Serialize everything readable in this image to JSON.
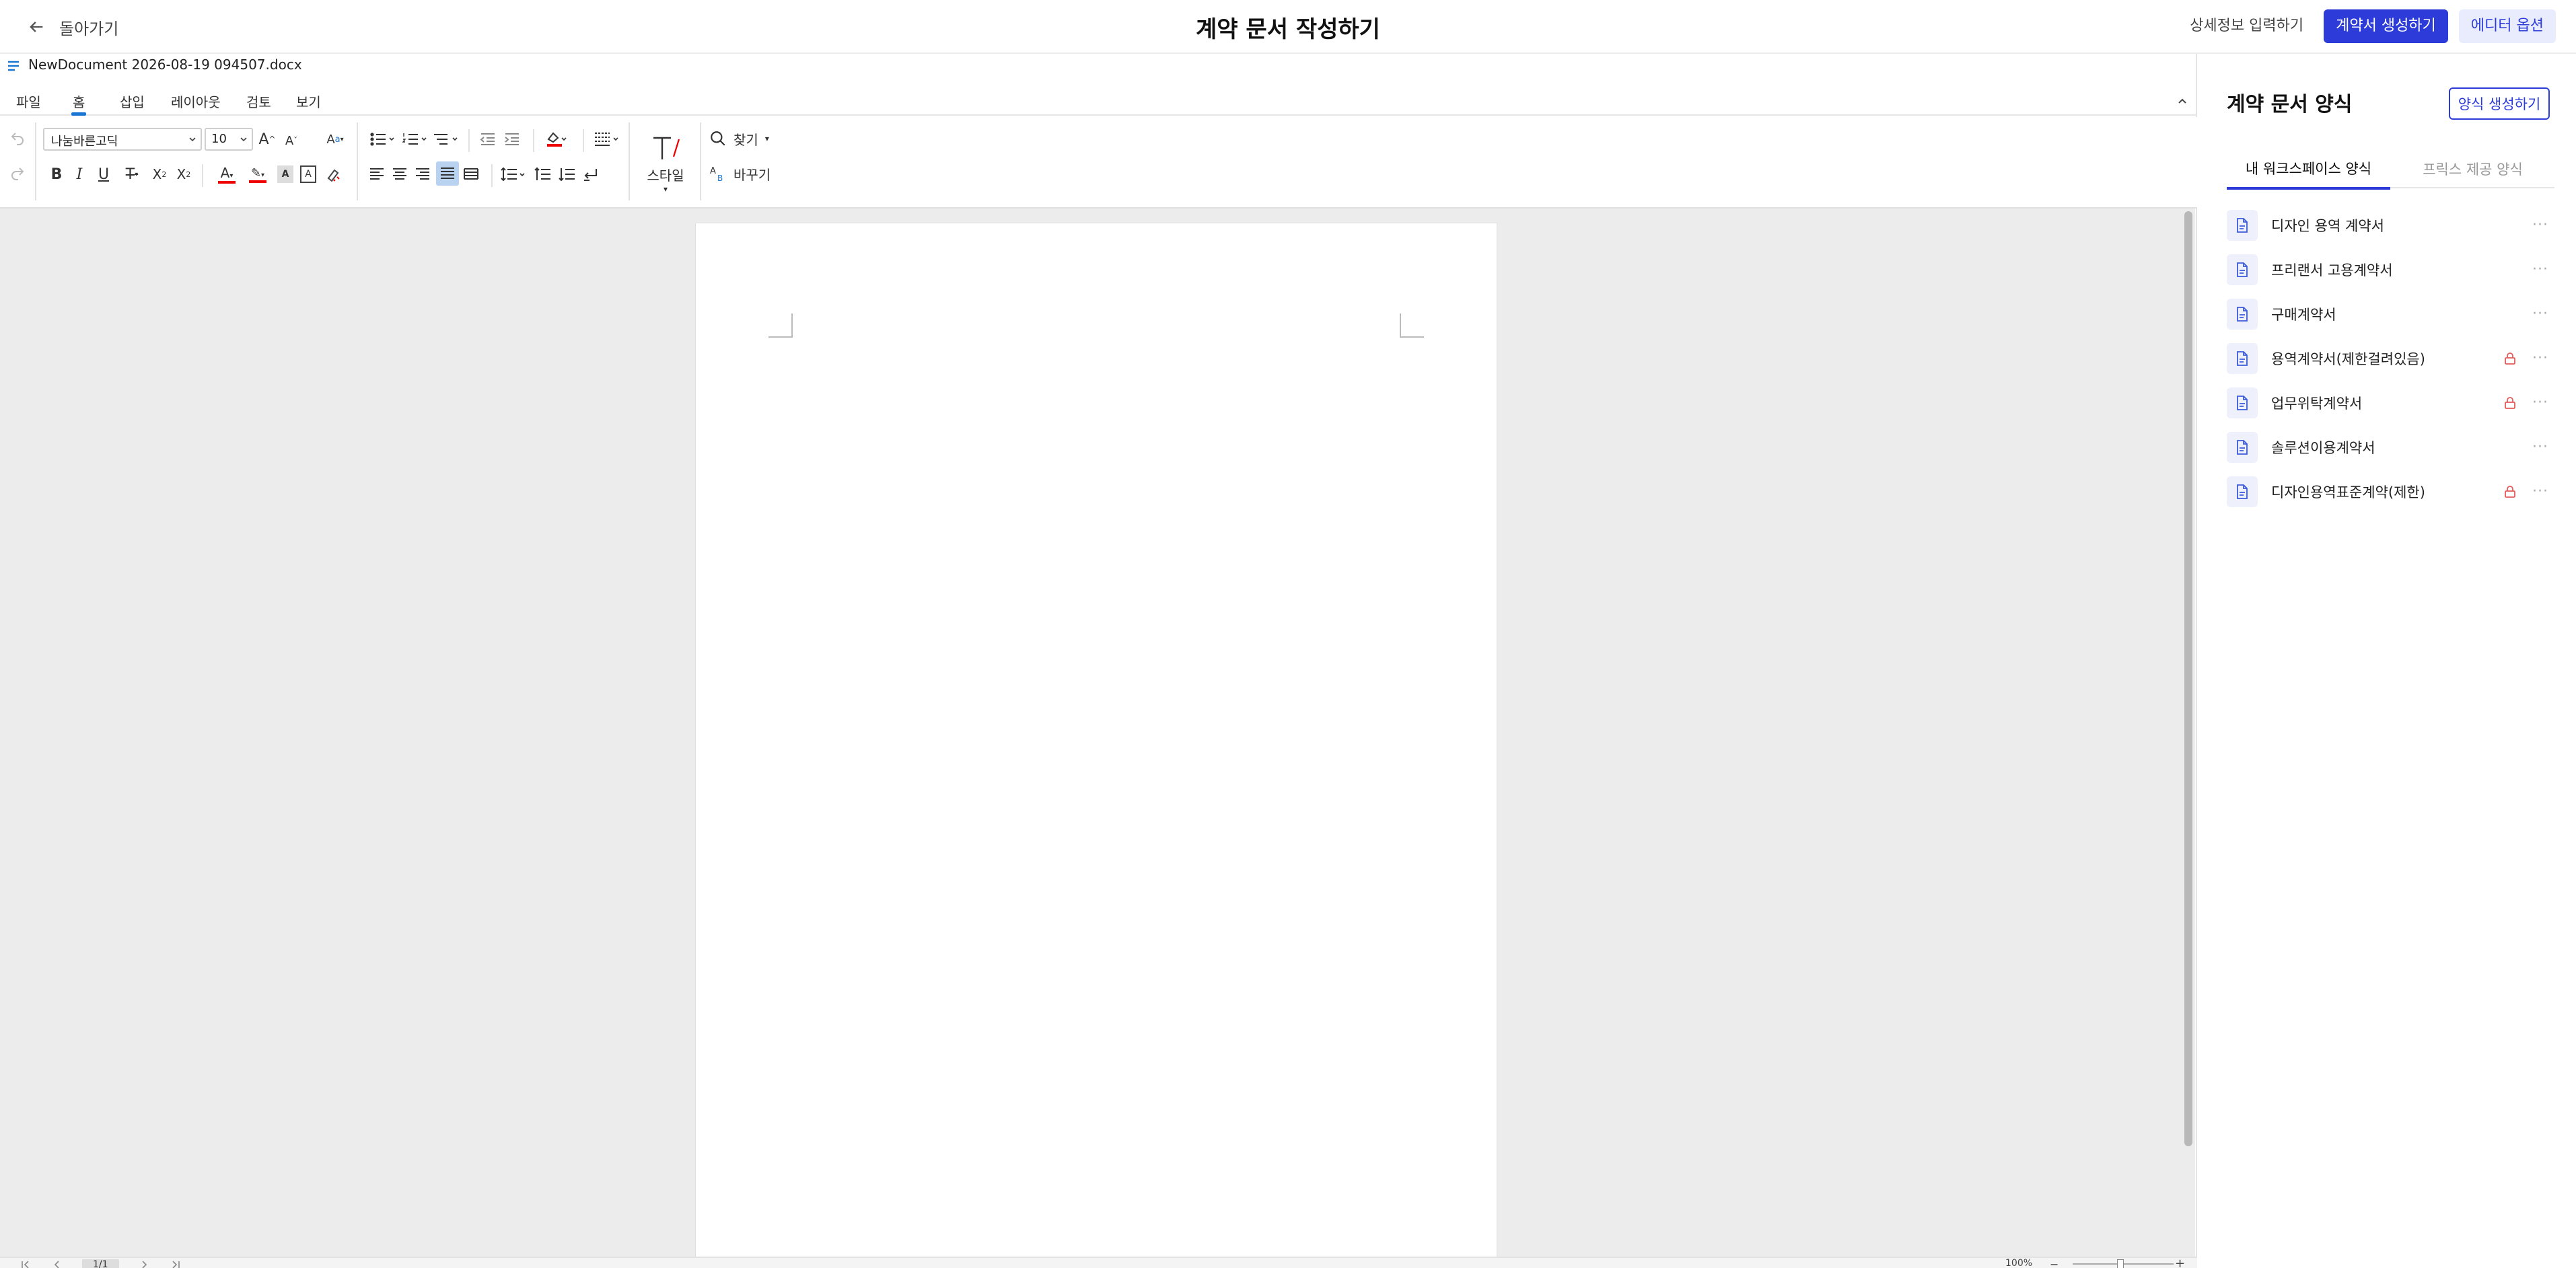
{
  "header": {
    "back_label": "돌아가기",
    "title": "계약 문서 작성하기",
    "detail_label": "상세정보 입력하기",
    "generate_label": "계약서 생성하기",
    "options_label": "에디터 옵션",
    "accent_color": "#2d3cd8"
  },
  "editor": {
    "filename": "NewDocument 2026-08-19 094507.docx",
    "menu": [
      "파일",
      "홈",
      "삽입",
      "레이아웃",
      "검토",
      "보기"
    ],
    "active_menu": "홈",
    "font_name": "나눔바른고딕",
    "font_size": "10",
    "style_label": "스타일",
    "find_label": "찾기",
    "replace_label": "바꾸기",
    "status": {
      "page": "1/1",
      "zoom": "100%"
    }
  },
  "sidebar": {
    "title": "계약 문서 양식",
    "create_label": "양식 생성하기",
    "tabs": [
      "내 워크스페이스 양식",
      "프릭스 제공 양식"
    ],
    "active_tab": 0,
    "templates": [
      {
        "name": "디자인 용역 계약서",
        "locked": false
      },
      {
        "name": "프리랜서 고용계약서",
        "locked": false
      },
      {
        "name": "구매계약서",
        "locked": false
      },
      {
        "name": "용역계약서(제한걸려있음)",
        "locked": true
      },
      {
        "name": "업무위탁계약서",
        "locked": true
      },
      {
        "name": "솔루션이용계약서",
        "locked": false
      },
      {
        "name": "디자인용역표준계약(제한)",
        "locked": true
      }
    ],
    "lock_color": "#e35a5a"
  }
}
